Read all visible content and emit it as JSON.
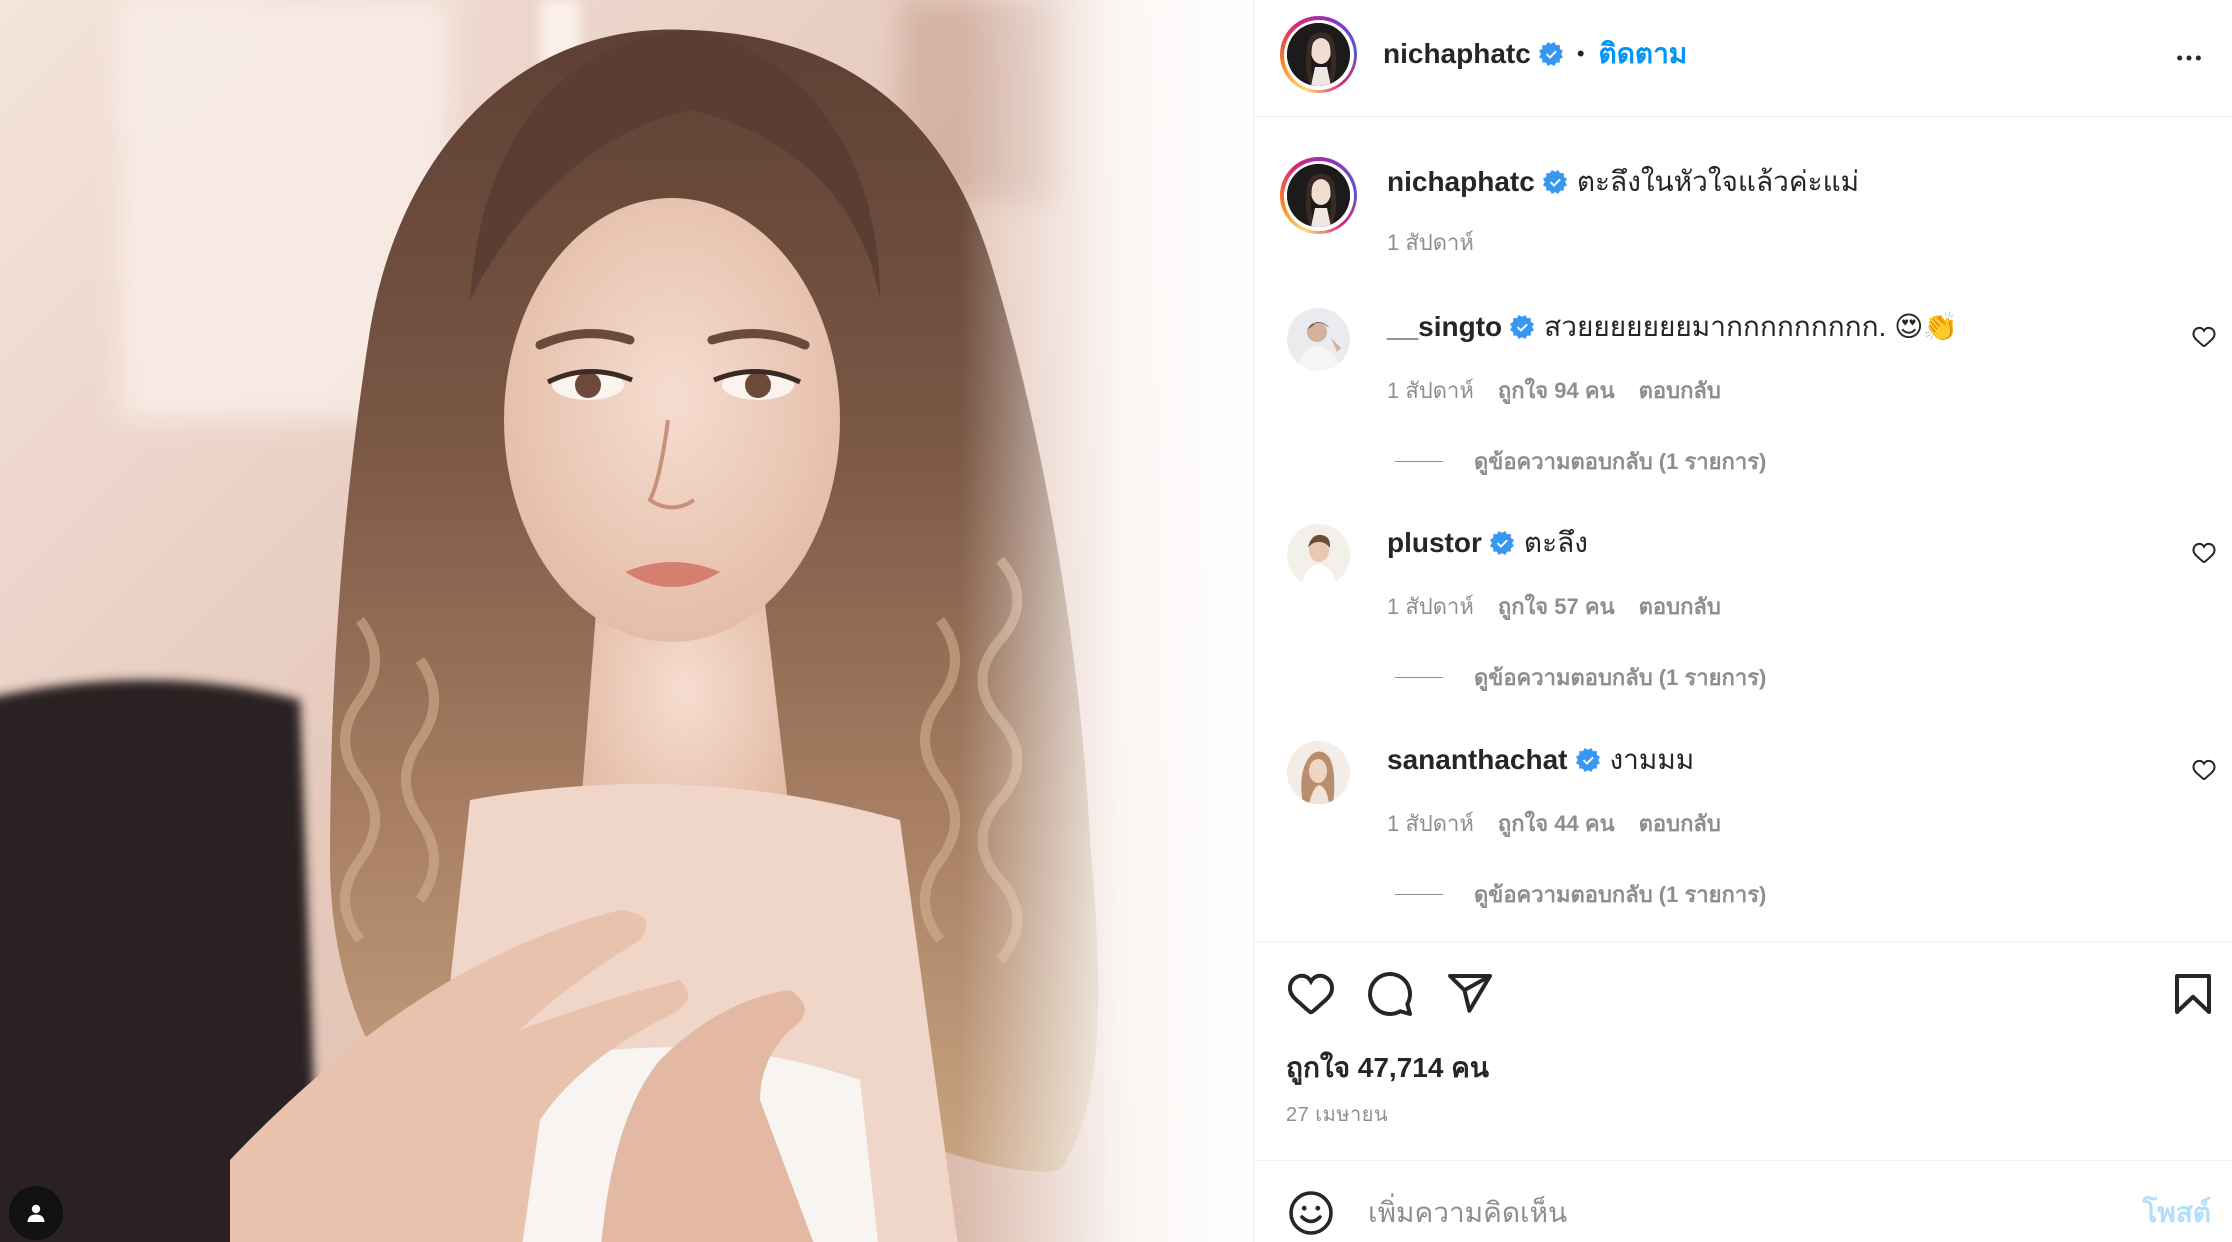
{
  "header": {
    "username": "nichaphatc",
    "separator": "•",
    "follow_label": "ติดตาม",
    "verified": true
  },
  "caption": {
    "username": "nichaphatc",
    "text": "ตะลึงในหัวใจแล้วค่ะแม่",
    "time": "1 สัปดาห์"
  },
  "comments": [
    {
      "username": "__singto",
      "text": "สวยยยยยยยมากกกกกกกกก. 😍👏",
      "time": "1 สัปดาห์",
      "likes": "ถูกใจ 94 คน",
      "reply_label": "ตอบกลับ",
      "view_replies": "ดูข้อความตอบกลับ (1 รายการ)"
    },
    {
      "username": "plustor",
      "text": "ตะลึง",
      "time": "1 สัปดาห์",
      "likes": "ถูกใจ 57 คน",
      "reply_label": "ตอบกลับ",
      "view_replies": "ดูข้อความตอบกลับ (1 รายการ)"
    },
    {
      "username": "sananthachat",
      "text": "งามมม",
      "time": "1 สัปดาห์",
      "likes": "ถูกใจ 44 คน",
      "reply_label": "ตอบกลับ",
      "view_replies": "ดูข้อความตอบกลับ (1 รายการ)"
    }
  ],
  "post": {
    "likes_text": "ถูกใจ 47,714 คน",
    "date": "27 เมษายน"
  },
  "comment_box": {
    "placeholder": "เพิ่มความคิดเห็น",
    "post_label": "โพสต์"
  },
  "icons": {
    "tag": "user-tag-icon",
    "more": "more-options-icon",
    "verified": "verified-badge-icon",
    "like": "heart-icon",
    "comment": "comment-icon",
    "share": "share-icon",
    "save": "bookmark-icon",
    "emoji": "emoji-icon",
    "comment_like": "small-heart-icon"
  },
  "colors": {
    "accent": "#0095f6",
    "post_button_disabled": "#b2dffc",
    "secondary_text": "#8e8e8e",
    "primary_text": "#262626",
    "divider": "#efefef"
  }
}
